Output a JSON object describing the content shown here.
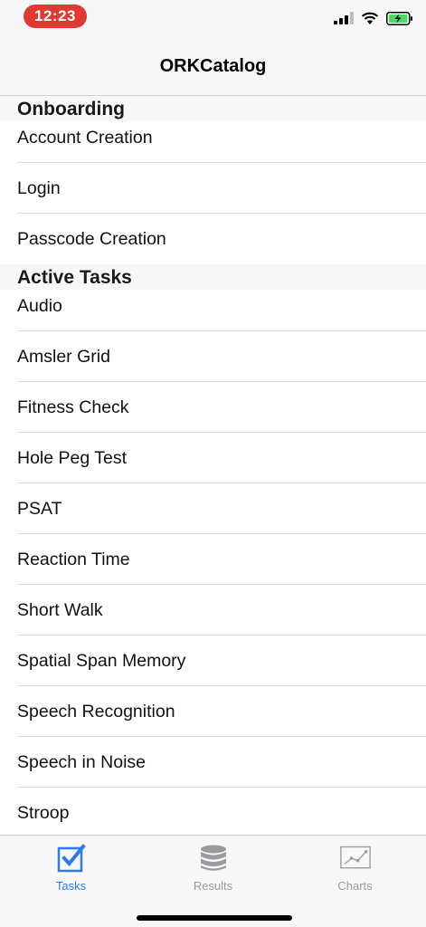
{
  "status_bar": {
    "time": "12:23"
  },
  "nav": {
    "title": "ORKCatalog"
  },
  "sections": [
    {
      "header": "Onboarding",
      "items": [
        "Account Creation",
        "Login",
        "Passcode Creation"
      ]
    },
    {
      "header": "Active Tasks",
      "items": [
        "Audio",
        "Amsler Grid",
        "Fitness Check",
        "Hole Peg Test",
        "PSAT",
        "Reaction Time",
        "Short Walk",
        "Spatial Span Memory",
        "Speech Recognition",
        "Speech in Noise",
        "Stroop"
      ]
    }
  ],
  "tabs": [
    {
      "label": "Tasks",
      "icon": "checkbox-icon",
      "active": true
    },
    {
      "label": "Results",
      "icon": "database-icon",
      "active": false
    },
    {
      "label": "Charts",
      "icon": "chart-icon",
      "active": false
    }
  ],
  "colors": {
    "accent": "#2f7be5",
    "time_pill": "#e0392f",
    "battery": "#4cd964"
  }
}
